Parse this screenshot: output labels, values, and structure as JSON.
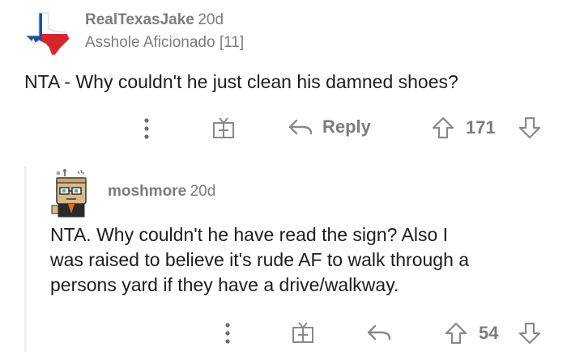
{
  "comment1": {
    "username": "RealTexasJake",
    "time": "20d",
    "flair": "Asshole Aficionado [11]",
    "body": "NTA - Why couldn't he just clean his damned shoes?",
    "reply_label": "Reply",
    "votes": "171",
    "avatar_icon": "texas-flag-avatar"
  },
  "comment2": {
    "username": "moshmore",
    "time": "20d",
    "body_lines": [
      "NTA. Why couldn't he have read the sign? Also I",
      "was raised to believe it's rude AF to walk through a",
      "persons yard if they have a drive/walkway."
    ],
    "votes": "54",
    "avatar_icon": "snoo-robot-avatar"
  },
  "colors": {
    "text": "#1c1c1c",
    "muted": "#7c7c7c",
    "icon": "#878a8c",
    "thread_line": "#edeff1",
    "flag_blue": "#1f4f9a",
    "flag_red": "#d6262d"
  },
  "icons": {
    "more": "more-options-icon",
    "award": "award-gift-icon",
    "reply": "reply-arrow-icon",
    "upvote": "upvote-arrow-icon",
    "downvote": "downvote-arrow-icon"
  }
}
